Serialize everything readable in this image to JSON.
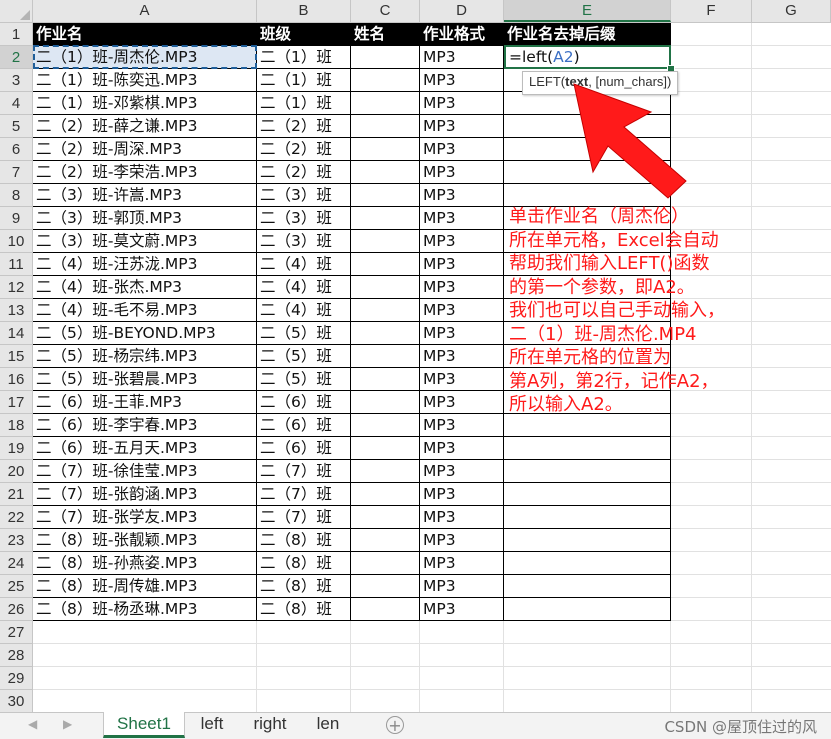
{
  "columns": [
    "A",
    "B",
    "C",
    "D",
    "E",
    "F",
    "G"
  ],
  "rows": [
    "1",
    "2",
    "3",
    "4",
    "5",
    "6",
    "7",
    "8",
    "9",
    "10",
    "11",
    "12",
    "13",
    "14",
    "15",
    "16",
    "17",
    "18",
    "19",
    "20",
    "21",
    "22",
    "23",
    "24",
    "25",
    "26",
    "27",
    "28",
    "29",
    "30"
  ],
  "header_row": [
    "作业名",
    "班级",
    "姓名",
    "作业格式",
    "作业名去掉后缀"
  ],
  "data_rows": [
    [
      "二（1）班-周杰伦.MP3",
      "二（1）班",
      "",
      "MP3"
    ],
    [
      "二（1）班-陈奕迅.MP3",
      "二（1）班",
      "",
      "MP3"
    ],
    [
      "二（1）班-邓紫棋.MP3",
      "二（1）班",
      "",
      "MP3"
    ],
    [
      "二（2）班-薛之谦.MP3",
      "二（2）班",
      "",
      "MP3"
    ],
    [
      "二（2）班-周深.MP3",
      "二（2）班",
      "",
      "MP3"
    ],
    [
      "二（2）班-李荣浩.MP3",
      "二（2）班",
      "",
      "MP3"
    ],
    [
      "二（3）班-许嵩.MP3",
      "二（3）班",
      "",
      "MP3"
    ],
    [
      "二（3）班-郭顶.MP3",
      "二（3）班",
      "",
      "MP3"
    ],
    [
      "二（3）班-莫文蔚.MP3",
      "二（3）班",
      "",
      "MP3"
    ],
    [
      "二（4）班-汪苏泷.MP3",
      "二（4）班",
      "",
      "MP3"
    ],
    [
      "二（4）班-张杰.MP3",
      "二（4）班",
      "",
      "MP3"
    ],
    [
      "二（4）班-毛不易.MP3",
      "二（4）班",
      "",
      "MP3"
    ],
    [
      "二（5）班-BEYOND.MP3",
      "二（5）班",
      "",
      "MP3"
    ],
    [
      "二（5）班-杨宗纬.MP3",
      "二（5）班",
      "",
      "MP3"
    ],
    [
      "二（5）班-张碧晨.MP3",
      "二（5）班",
      "",
      "MP3"
    ],
    [
      "二（6）班-王菲.MP3",
      "二（6）班",
      "",
      "MP3"
    ],
    [
      "二（6）班-李宇春.MP3",
      "二（6）班",
      "",
      "MP3"
    ],
    [
      "二（6）班-五月天.MP3",
      "二（6）班",
      "",
      "MP3"
    ],
    [
      "二（7）班-徐佳莹.MP3",
      "二（7）班",
      "",
      "MP3"
    ],
    [
      "二（7）班-张韵涵.MP3",
      "二（7）班",
      "",
      "MP3"
    ],
    [
      "二（7）班-张学友.MP3",
      "二（7）班",
      "",
      "MP3"
    ],
    [
      "二（8）班-张靓颖.MP3",
      "二（8）班",
      "",
      "MP3"
    ],
    [
      "二（8）班-孙燕姿.MP3",
      "二（8）班",
      "",
      "MP3"
    ],
    [
      "二（8）班-周传雄.MP3",
      "二（8）班",
      "",
      "MP3"
    ],
    [
      "二（8）班-杨丞琳.MP3",
      "二（8）班",
      "",
      "MP3"
    ]
  ],
  "active_cell": {
    "formula_prefix": "=left(",
    "formula_ref": "A2",
    "formula_suffix": ")"
  },
  "tooltip": {
    "fn": "LEFT(",
    "arg1": "text",
    "rest": ", [num_chars])"
  },
  "annotation_lines": [
    "单击作业名（周杰伦）",
    "所在单元格，Excel会自动",
    "帮助我们输入LEFT()函数",
    "的第一个参数，即A2。",
    "我们也可以自己手动输入，",
    "二（1）班-周杰伦.MP4",
    "所在单元格的位置为",
    "第A列，第2行，记作A2，",
    "所以输入A2。"
  ],
  "tabs": [
    "Sheet1",
    "left",
    "right",
    "len"
  ],
  "active_tab": "Sheet1",
  "add_sheet_symbol": "+",
  "nav_prev": "◀",
  "nav_next": "▶",
  "watermark": "CSDN @屋顶住过的风",
  "colors": {
    "accent": "#217346",
    "annotation": "#ff1a1a",
    "header_bg": "#000000",
    "header_text": "#ffffff"
  }
}
